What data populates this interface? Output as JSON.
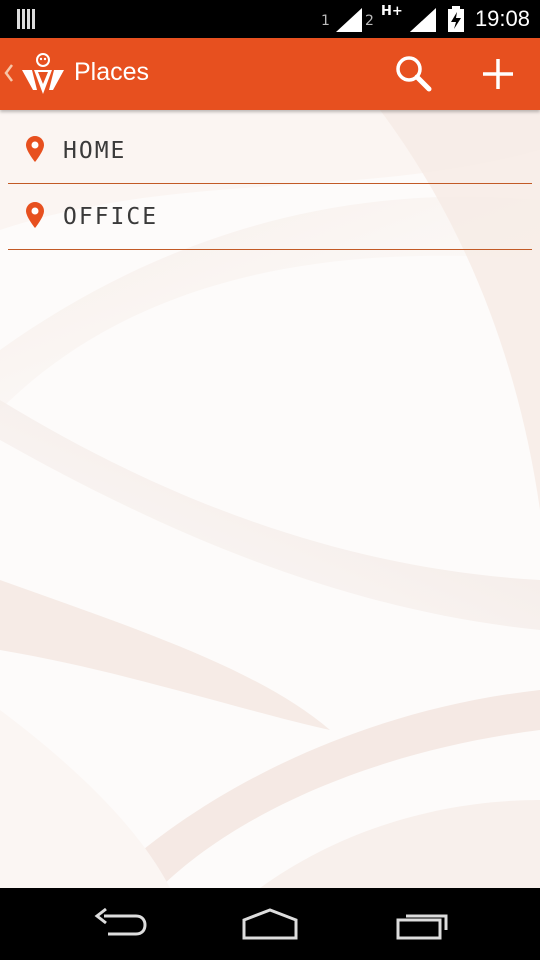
{
  "status_bar": {
    "sim1": "1",
    "sim2": "2",
    "network": "H+",
    "time": "19:08",
    "icons": [
      "notification-icon",
      "signal-icon",
      "signal-icon",
      "battery-charging-icon"
    ]
  },
  "app_bar": {
    "title": "Places",
    "logo": "app-logo-icon",
    "actions": [
      "search-icon",
      "add-icon"
    ]
  },
  "places": [
    {
      "label": "HOME",
      "icon": "location-pin-icon"
    },
    {
      "label": "OFFICE",
      "icon": "location-pin-icon"
    }
  ],
  "nav_bar": {
    "buttons": [
      "back-icon",
      "home-icon",
      "recent-apps-icon"
    ]
  },
  "colors": {
    "accent": "#e7501f",
    "divider": "#c25a26",
    "label": "#3a3a3a"
  }
}
